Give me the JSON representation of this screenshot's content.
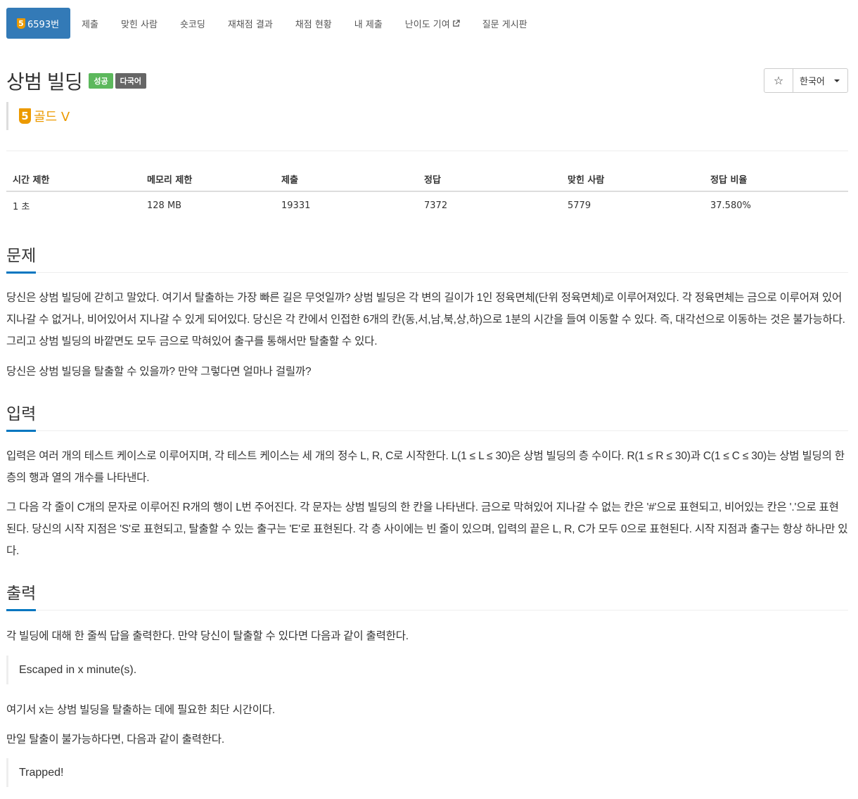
{
  "nav": {
    "problem_tab": {
      "tier": "5",
      "number": "6593번"
    },
    "tabs": [
      "제출",
      "맞힌 사람",
      "숏코딩",
      "재채점 결과",
      "채점 현황",
      "내 제출",
      "난이도 기여",
      "질문 게시판"
    ]
  },
  "problem": {
    "title": "상범 빌딩",
    "labels": {
      "success": "성공",
      "multi": "다국어"
    },
    "tier_badge": "5",
    "tier_text": "골드 V",
    "star_icon": "☆",
    "language": "한국어"
  },
  "stats": {
    "headers": [
      "시간 제한",
      "메모리 제한",
      "제출",
      "정답",
      "맞힌 사람",
      "정답 비율"
    ],
    "values": [
      "1 초",
      "128 MB",
      "19331",
      "7372",
      "5779",
      "37.580%"
    ]
  },
  "sections": {
    "problem": {
      "title": "문제",
      "p1": "당신은 상범 빌딩에 갇히고 말았다. 여기서 탈출하는 가장 빠른 길은 무엇일까? 상범 빌딩은 각 변의 길이가 1인 정육면체(단위 정육면체)로 이루어져있다. 각 정육면체는 금으로 이루어져 있어 지나갈 수 없거나, 비어있어서 지나갈 수 있게 되어있다. 당신은 각 칸에서 인접한 6개의 칸(동,서,남,북,상,하)으로 1분의 시간을 들여 이동할 수 있다. 즉, 대각선으로 이동하는 것은 불가능하다. 그리고 상범 빌딩의 바깥면도 모두 금으로 막혀있어 출구를 통해서만 탈출할 수 있다.",
      "p2": "당신은 상범 빌딩을 탈출할 수 있을까? 만약 그렇다면 얼마나 걸릴까?"
    },
    "input": {
      "title": "입력",
      "p1": "입력은 여러 개의 테스트 케이스로 이루어지며, 각 테스트 케이스는 세 개의 정수 L, R, C로 시작한다. L(1 ≤ L ≤ 30)은 상범 빌딩의 층 수이다. R(1 ≤ R ≤ 30)과 C(1 ≤ C ≤ 30)는 상범 빌딩의 한 층의 행과 열의 개수를 나타낸다.",
      "p2": "그 다음 각 줄이 C개의 문자로 이루어진 R개의 행이 L번 주어진다. 각 문자는 상범 빌딩의 한 칸을 나타낸다. 금으로 막혀있어 지나갈 수 없는 칸은 '#'으로 표현되고, 비어있는 칸은 '.'으로 표현된다. 당신의 시작 지점은 'S'로 표현되고, 탈출할 수 있는 출구는 'E'로 표현된다. 각 층 사이에는 빈 줄이 있으며, 입력의 끝은 L, R, C가 모두 0으로 표현된다. 시작 지점과 출구는 항상 하나만 있다."
    },
    "output": {
      "title": "출력",
      "p1": "각 빌딩에 대해 한 줄씩 답을 출력한다. 만약 당신이 탈출할 수 있다면 다음과 같이 출력한다.",
      "sample1": "Escaped in x minute(s).",
      "p2": "여기서 x는 상범 빌딩을 탈출하는 데에 필요한 최단 시간이다.",
      "p3": "만일 탈출이 불가능하다면, 다음과 같이 출력한다.",
      "sample2": "Trapped!"
    }
  }
}
